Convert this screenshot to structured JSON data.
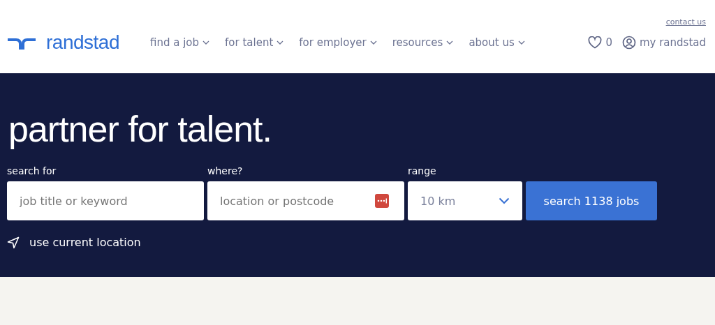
{
  "header": {
    "top_link": "contact us",
    "logo_text": "randstad",
    "nav": [
      {
        "label": "find a job"
      },
      {
        "label": "for talent"
      },
      {
        "label": "for employer"
      },
      {
        "label": "resources"
      },
      {
        "label": "about us"
      }
    ],
    "favorites_count": "0",
    "account_label": "my randstad"
  },
  "hero": {
    "title": "partner for talent.",
    "fields": [
      {
        "kind": "text",
        "label": "search for",
        "placeholder": "job title or keyword"
      },
      {
        "kind": "location",
        "label": "where?",
        "placeholder": "location or postcode"
      },
      {
        "kind": "select",
        "label": "range",
        "value": "10 km"
      }
    ],
    "search_button": "search 1138 jobs",
    "location_link": "use current location"
  }
}
